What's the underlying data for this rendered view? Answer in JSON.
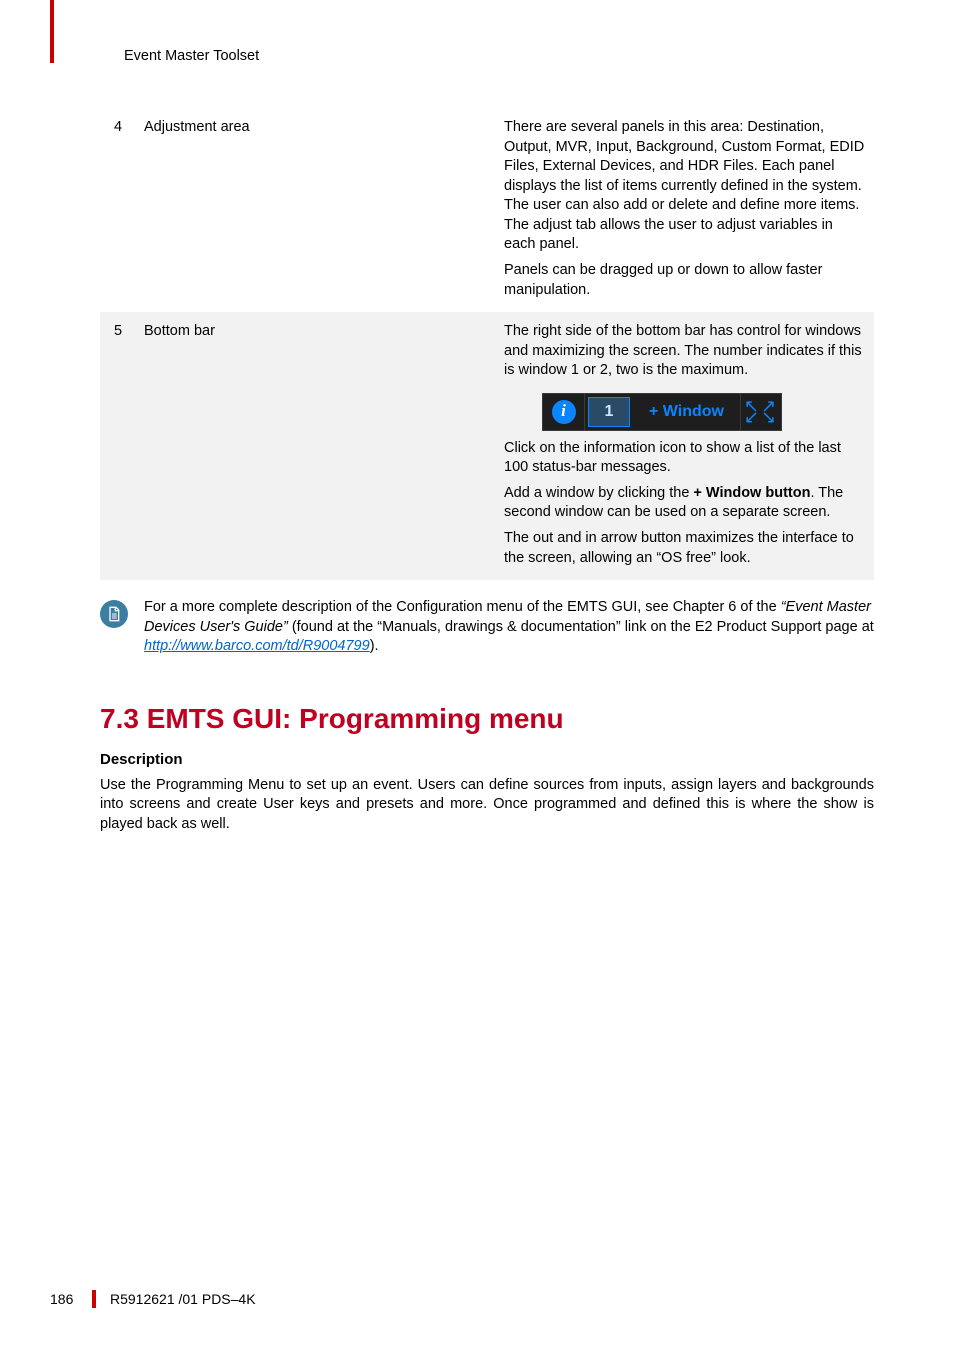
{
  "header": {
    "title": "Event Master Toolset"
  },
  "rows": [
    {
      "num": "4",
      "label": "Adjustment area",
      "desc": {
        "p1": "There are several panels in this area: Destination, Output, MVR, Input, Background, Custom Format, EDID Files, External Devices, and HDR Files. Each panel displays the list of items currently defined in the system. The user can also add or delete and define more items. The adjust tab allows the user to adjust variables in each panel.",
        "p2": "Panels can be dragged up or down to allow faster manipulation."
      }
    },
    {
      "num": "5",
      "label": "Bottom bar",
      "desc": {
        "p1": "The right side of the bottom bar has control for windows and maximizing the screen. The number indicates if this is window 1 or 2, two is the maximum.",
        "p2": "Click on the information icon to show a list of the last 100 status-bar messages.",
        "p3a": "Add a window by clicking the ",
        "p3b": "+ Window button",
        "p3c": ". The second window can be used on a separate screen.",
        "p4": "The out and in arrow button maximizes the interface to the screen, allowing an “OS free” look."
      }
    }
  ],
  "bottom_bar": {
    "info_glyph": "i",
    "window_number": "1",
    "window_button_label": "+ Window"
  },
  "note": {
    "t1": "For a more complete description of the Configuration menu of the EMTS GUI, see Chapter 6 of the ",
    "t2": "“Event Master Devices User's Guide”",
    "t3": " (found at the “Manuals, drawings & documentation” link on the E2 Product Support page at ",
    "link": "http://www.barco.com/td/R9004799",
    "t4": ")."
  },
  "section": {
    "heading": "7.3 EMTS GUI: Programming menu",
    "sub": "Description",
    "body": "Use the Programming Menu to set up an event. Users can define sources from inputs, assign layers and backgrounds into screens and create User keys and presets and more. Once programmed and defined this is where the show is played back as well."
  },
  "footer": {
    "page": "186",
    "doc": "R5912621 /01 PDS–4K"
  }
}
